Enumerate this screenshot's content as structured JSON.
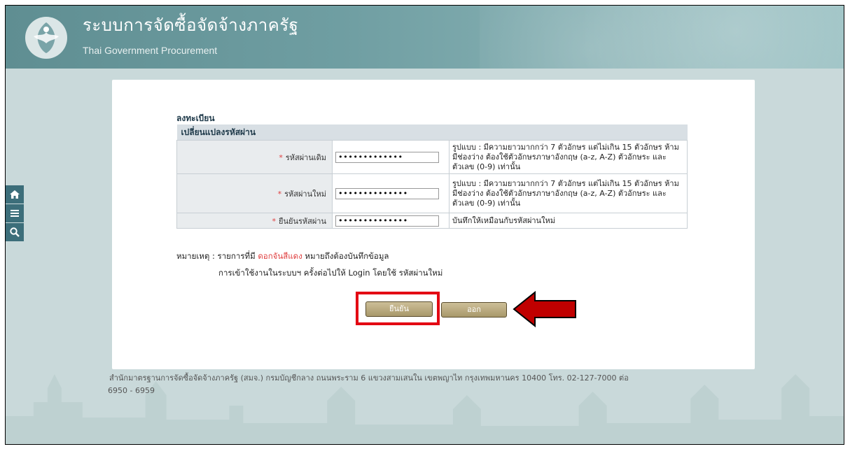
{
  "header": {
    "title": "ระบบการจัดซื้อจัดจ้างภาครัฐ",
    "subtitle": "Thai Government Procurement"
  },
  "rail": {
    "items": [
      "home-icon",
      "menu-icon",
      "search-icon"
    ]
  },
  "page": {
    "title": "ลงทะเบียน",
    "section": "เปลี่ยนแปลงรหัสผ่าน"
  },
  "form": {
    "rows": [
      {
        "label": "รหัสผ่านเดิม",
        "value": "•••••••••••••",
        "hint": "รูปแบบ : มีความยาวมากกว่า 7 ตัวอักษร แต่ไม่เกิน 15 ตัวอักษร ห้ามมีช่องว่าง ต้องใช้ตัวอักษรภาษาอังกฤษ (a-z, A-Z) ตัวอักษระ และตัวเลข (0-9) เท่านั้น"
      },
      {
        "label": "รหัสผ่านใหม่",
        "value": "••••••••••••••",
        "hint": "รูปแบบ : มีความยาวมากกว่า 7 ตัวอักษร แต่ไม่เกิน 15 ตัวอักษร ห้ามมีช่องว่าง ต้องใช้ตัวอักษรภาษาอังกฤษ (a-z, A-Z) ตัวอักษระ และตัวเลข (0-9) เท่านั้น"
      },
      {
        "label": "ยืนยันรหัสผ่าน",
        "value": "••••••••••••••",
        "hint": "บันทึกให้เหมือนกับรหัสผ่านใหม่"
      }
    ],
    "required_mark": "*"
  },
  "notes": {
    "prefix": "หมายเหตุ : รายการที่มี ",
    "red_text": "ดอกจันสีแดง",
    "suffix": " หมายถึงต้องบันทึกข้อมูล",
    "line2": "การเข้าใช้งานในระบบฯ ครั้งต่อไปให้ Login โดยใช้ รหัสผ่านใหม่"
  },
  "buttons": {
    "confirm": "ยืนยัน",
    "exit": "ออก"
  },
  "footer": {
    "line1": "สำนักมาตรฐานการจัดซื้อจัดจ้างภาครัฐ (สมจ.) กรมบัญชีกลาง ถนนพระราม 6 แขวงสามเสนใน เขตพญาไท กรุงเทพมหานคร 10400 โทร. 02-127-7000 ต่อ",
    "line2": "6950 - 6959"
  },
  "colors": {
    "header": "#6f9ea2",
    "required": "#e04040",
    "highlight": "#e30613",
    "arrow": "#c00000"
  }
}
